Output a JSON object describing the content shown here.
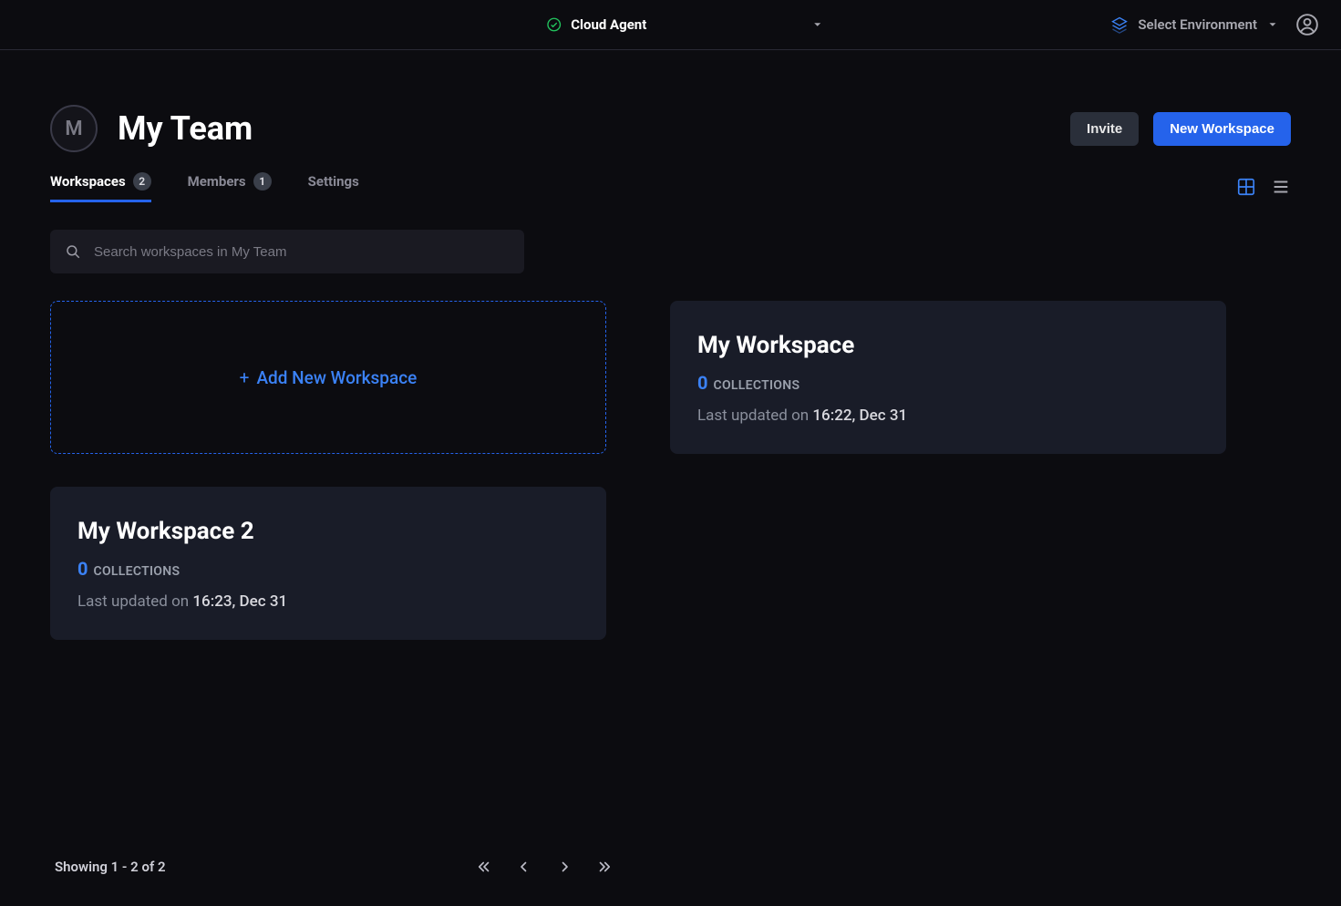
{
  "topbar": {
    "agent_label": "Cloud Agent",
    "env_label": "Select Environment"
  },
  "team": {
    "avatar_letter": "M",
    "title": "My Team"
  },
  "actions": {
    "invite": "Invite",
    "new_workspace": "New Workspace"
  },
  "tabs": {
    "workspaces_label": "Workspaces",
    "workspaces_count": "2",
    "members_label": "Members",
    "members_count": "1",
    "settings_label": "Settings"
  },
  "search": {
    "placeholder": "Search workspaces in My Team"
  },
  "add_card": {
    "label": "Add New Workspace",
    "plus": "+"
  },
  "collections_label": "COLLECTIONS",
  "updated_prefix": "Last updated on",
  "workspaces": [
    {
      "title": "My Workspace",
      "collections": "0",
      "updated": "16:22, Dec 31"
    },
    {
      "title": "My Workspace 2",
      "collections": "0",
      "updated": "16:23, Dec 31"
    }
  ],
  "footer": {
    "showing": "Showing 1 - 2 of 2"
  }
}
